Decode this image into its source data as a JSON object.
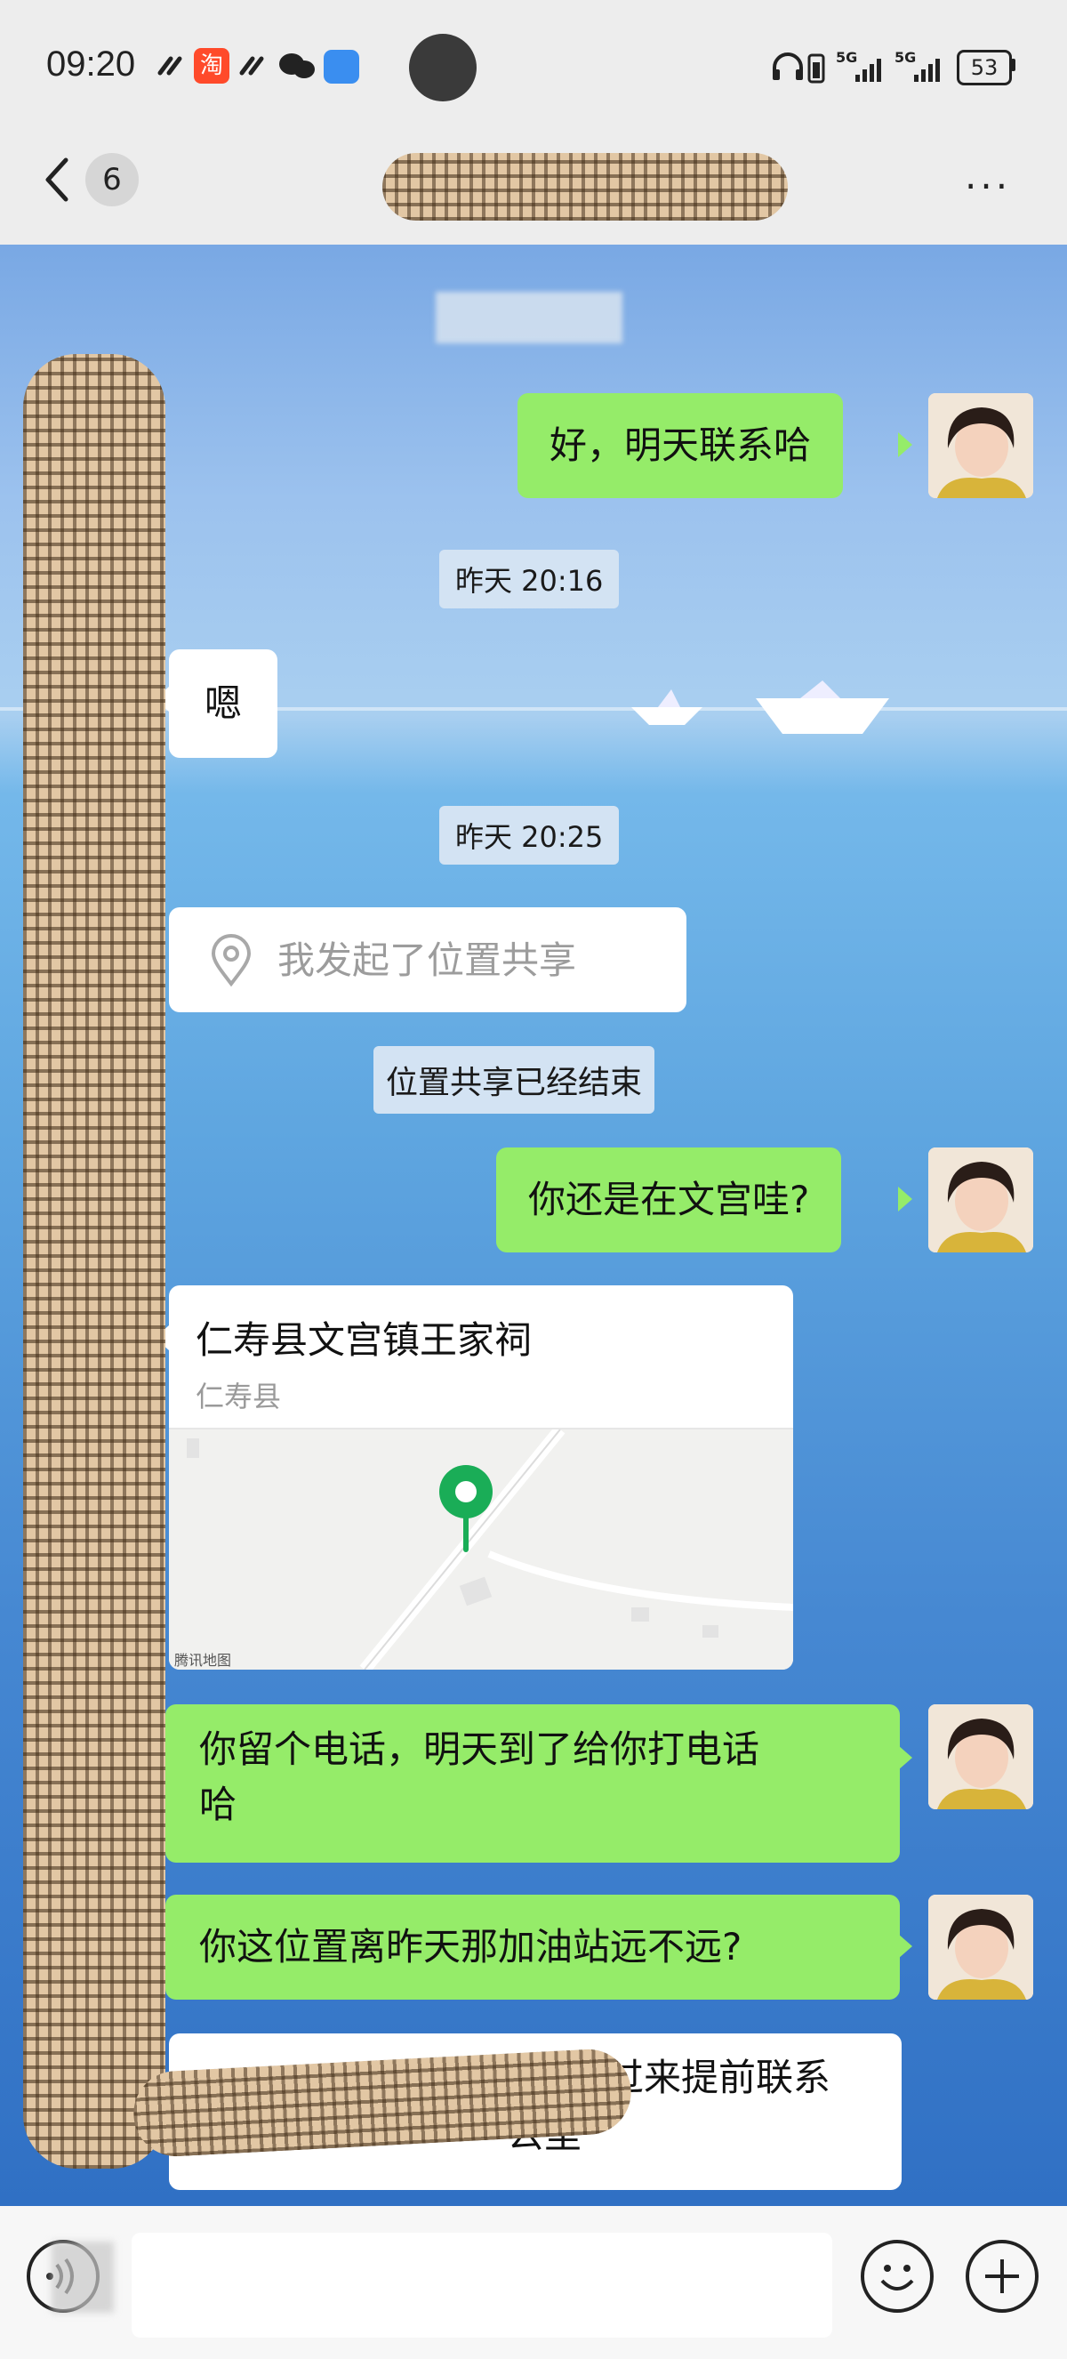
{
  "status_bar": {
    "time": "09:20",
    "left_icons": [
      "link-icon",
      "taobao-app-icon",
      "link-icon",
      "wechat-icon",
      "message-icon",
      "recording-dot-icon"
    ],
    "right_icons": [
      "headphones-icon",
      "battery-saver-icon",
      "signal-5g-icon",
      "signal-5g-icon"
    ],
    "battery": "53"
  },
  "nav": {
    "unread_count": "6",
    "more": "···"
  },
  "messages": {
    "m1": "好，明天联系哈",
    "t1": "昨天 20:16",
    "m2": "嗯",
    "t2": "昨天 20:25",
    "m3": "我发起了位置共享",
    "sys1": "位置共享已经结束",
    "m4": "你还是在文宫哇?",
    "location": {
      "title": "仁寿县文宫镇王家祠",
      "subtitle": "仁寿县",
      "map_credit": "腾讯地图"
    },
    "m5": "你留个电话，明天到了给你打电话哈",
    "m5_line1": "你留个电话，明天到了给你打电话",
    "m5_line2": "哈",
    "m6": "你这位置离昨天那加油站远不远?",
    "m7_visible_line1": "置过来提前联系",
    "m7_visible_line2": "公里"
  },
  "colors": {
    "my_bubble": "#95ec69",
    "other_bubble": "#ffffff",
    "map_pin": "#1aad57"
  }
}
